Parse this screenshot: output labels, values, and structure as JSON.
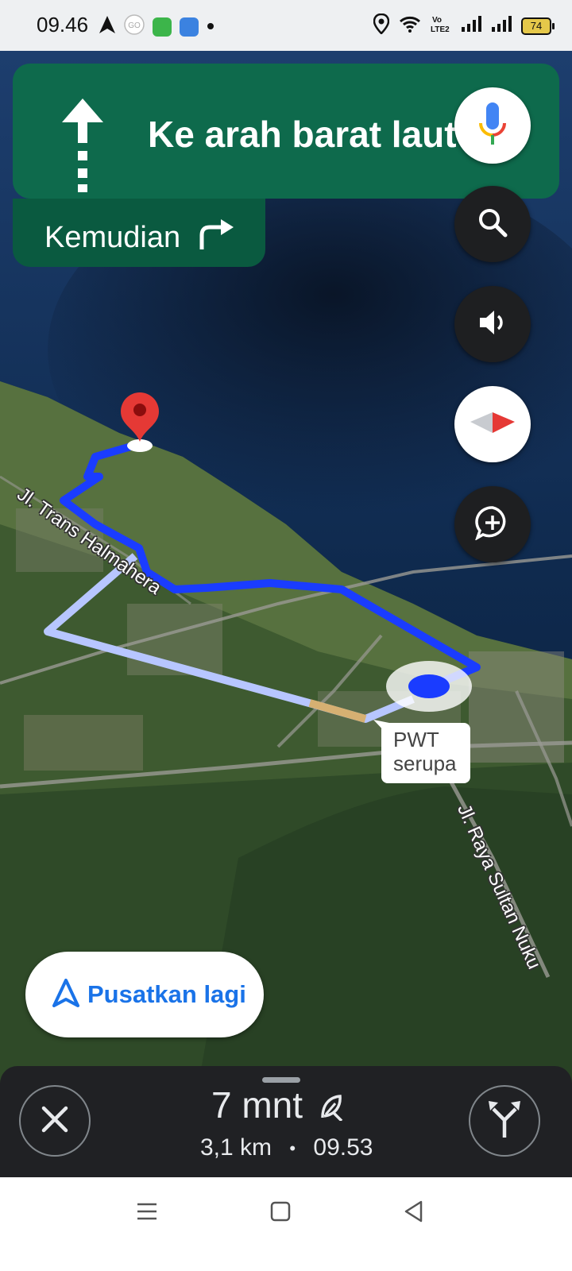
{
  "status_bar": {
    "time": "09.46",
    "battery": "74"
  },
  "navigation": {
    "instruction": "Ke arah barat laut",
    "then_label": "Kemudian"
  },
  "map": {
    "street_1": "Jl. Trans Halmahera",
    "street_2": "Jl. Raya Sultan Nuku",
    "callout_line1": "PWT",
    "callout_line2": "serupa"
  },
  "recenter": {
    "label": "Pusatkan lagi"
  },
  "trip": {
    "duration": "7 mnt",
    "distance": "3,1 km",
    "separator": "•",
    "arrival": "09.53"
  },
  "colors": {
    "banner": "#0e6a4c",
    "route": "#1a3cff",
    "alt_route": "#aebfff",
    "accent": "#1a73e8"
  }
}
